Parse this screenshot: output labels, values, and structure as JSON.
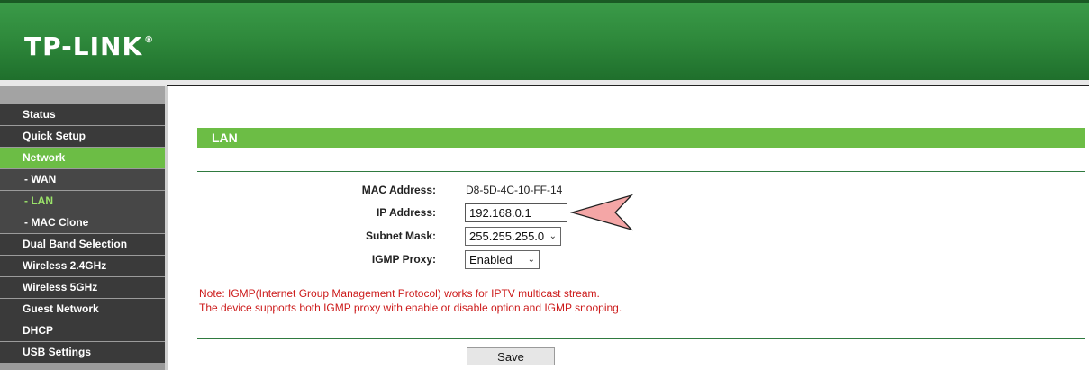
{
  "header": {
    "brand": "TP-LINK",
    "trademark": "®"
  },
  "sidebar": {
    "items": [
      {
        "label": "Status",
        "state": "normal"
      },
      {
        "label": "Quick Setup",
        "state": "normal"
      },
      {
        "label": "Network",
        "state": "active"
      },
      {
        "label": "- WAN",
        "state": "sub"
      },
      {
        "label": "- LAN",
        "state": "sub-current"
      },
      {
        "label": "- MAC Clone",
        "state": "sub"
      },
      {
        "label": "Dual Band Selection",
        "state": "normal"
      },
      {
        "label": "Wireless 2.4GHz",
        "state": "normal"
      },
      {
        "label": "Wireless 5GHz",
        "state": "normal"
      },
      {
        "label": "Guest Network",
        "state": "normal"
      },
      {
        "label": "DHCP",
        "state": "normal"
      },
      {
        "label": "USB Settings",
        "state": "normal"
      }
    ]
  },
  "main": {
    "title": "LAN",
    "mac": {
      "label": "MAC Address:",
      "value": "D8-5D-4C-10-FF-14"
    },
    "ip": {
      "label": "IP Address:",
      "value": "192.168.0.1"
    },
    "subnet": {
      "label": "Subnet Mask:",
      "value": "255.255.255.0"
    },
    "igmp": {
      "label": "IGMP Proxy:",
      "value": "Enabled"
    },
    "note_line1": "Note: IGMP(Internet Group Management Protocol) works for IPTV multicast stream.",
    "note_line2": "The device supports both IGMP proxy with enable or disable option and IGMP snooping.",
    "save_label": "Save"
  },
  "colors": {
    "header_green": "#2f8a3c",
    "accent_green": "#6cbd45",
    "menu_dark": "#3a3a3a",
    "note_red": "#cc1a1a",
    "pointer_pink": "#f4a6a6"
  }
}
